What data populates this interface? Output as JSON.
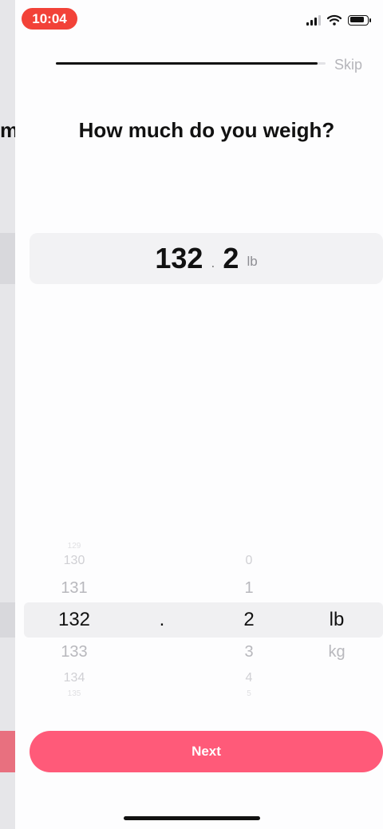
{
  "status_bar": {
    "time": "10:04",
    "icons": [
      "cellular-signal-icon",
      "wifi-icon",
      "battery-icon"
    ]
  },
  "header": {
    "progress_fraction": 0.97,
    "skip_label": "Skip"
  },
  "background_page": {
    "title_fragment": "m"
  },
  "question": {
    "title": "How much do you weigh?"
  },
  "display": {
    "whole": "132",
    "separator": ".",
    "decimal": "2",
    "unit": "lb"
  },
  "picker": {
    "whole_column": {
      "edge_above": "129",
      "items_above": [
        "130",
        "131"
      ],
      "selected": "132",
      "items_below": [
        "133",
        "134"
      ],
      "edge_below": "135"
    },
    "separator": ".",
    "decimal_column": {
      "items_above": [
        "0",
        "1"
      ],
      "selected": "2",
      "items_below": [
        "3",
        "4"
      ],
      "edge_below": "5"
    },
    "unit_column": {
      "selected": "lb",
      "items_below": [
        "kg"
      ]
    }
  },
  "actions": {
    "next_label": "Next"
  },
  "colors": {
    "accent": "#ff5a79",
    "time_pill": "#f24238",
    "text": "#111111",
    "muted": "#b5b5ba"
  }
}
